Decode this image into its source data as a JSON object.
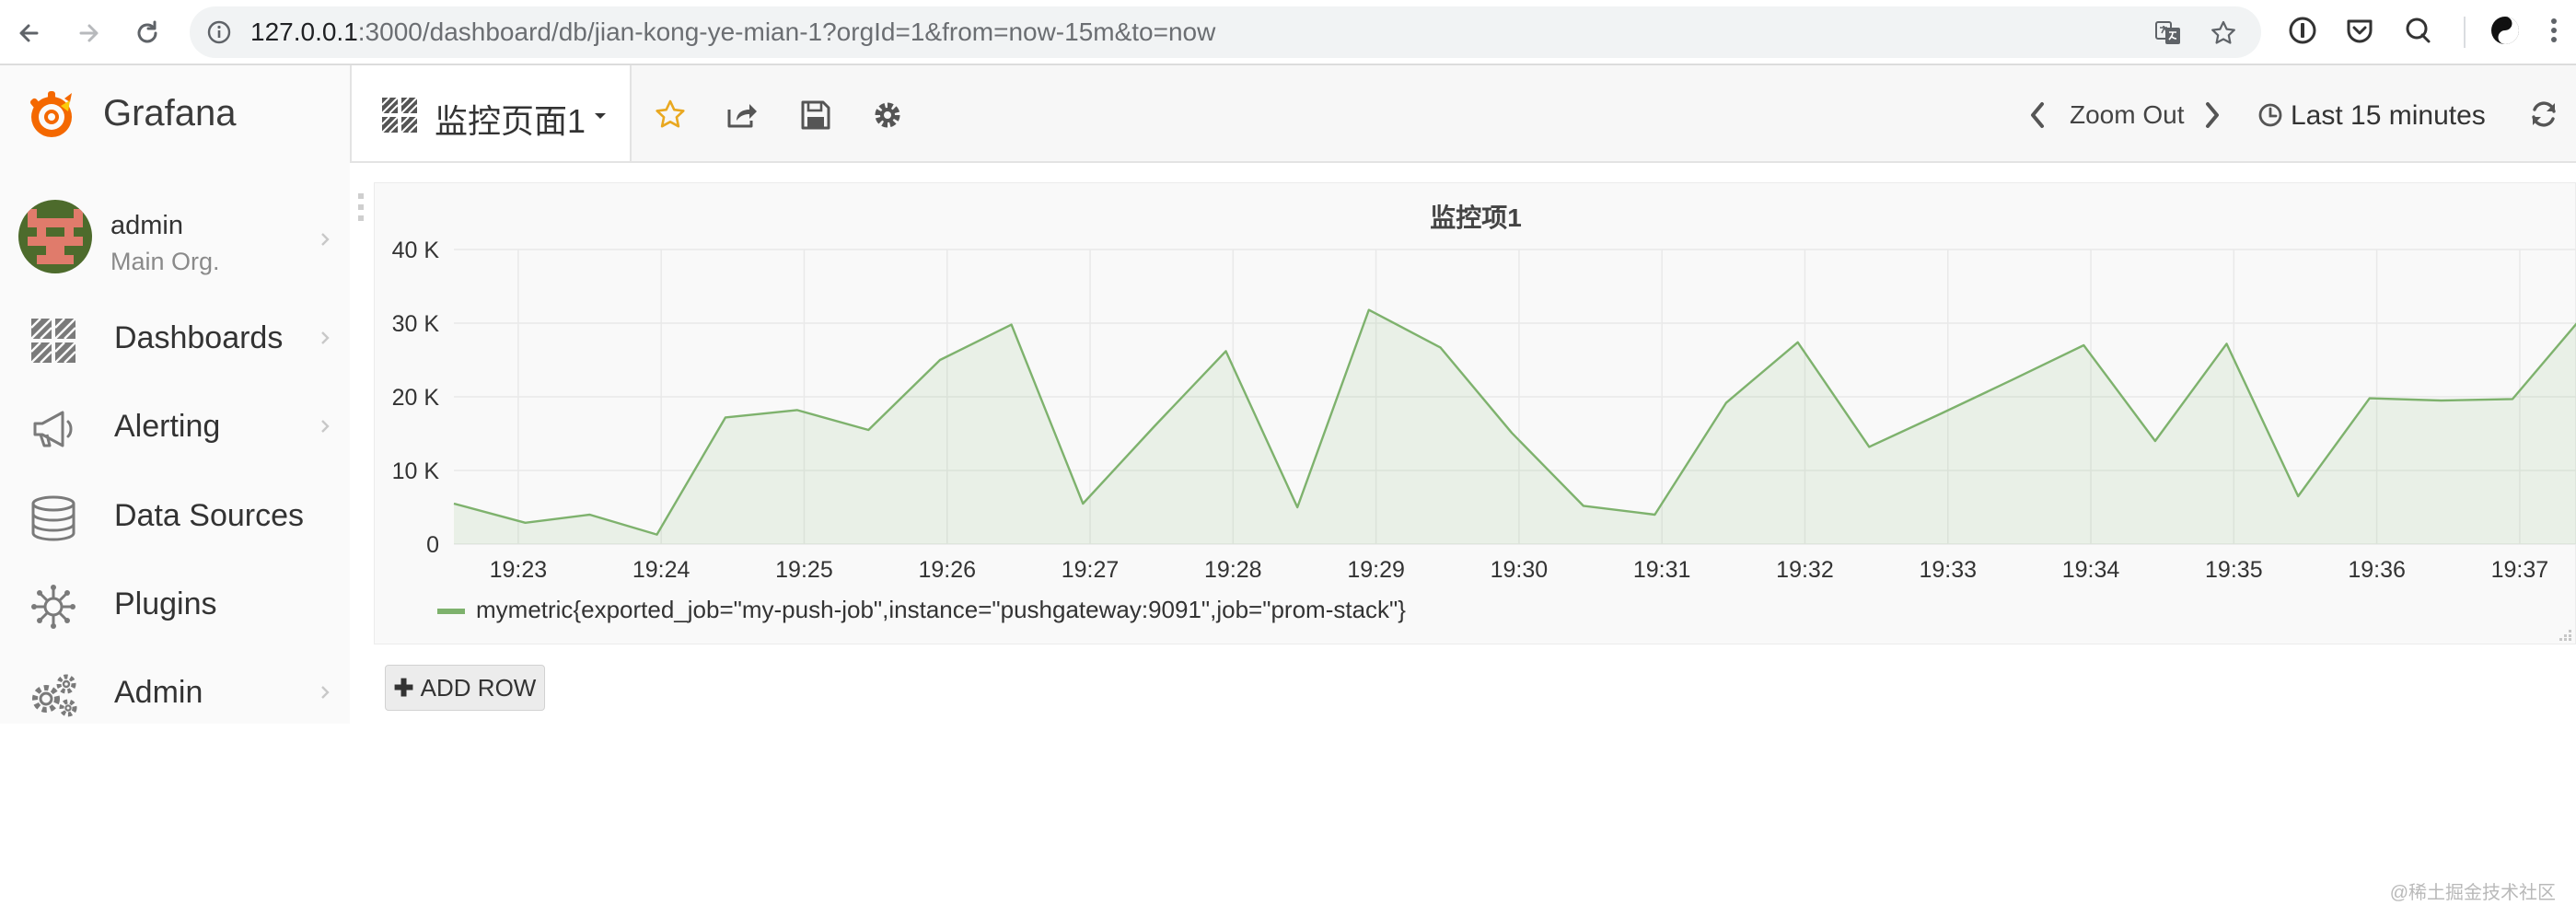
{
  "browser": {
    "url_host": "127.0.0.1",
    "url_rest": ":3000/dashboard/db/jian-kong-ye-mian-1?orgId=1&from=now-15m&to=now"
  },
  "brand": {
    "name": "Grafana",
    "color": "#f46800"
  },
  "user": {
    "name": "admin",
    "org": "Main Org."
  },
  "menu": [
    {
      "label": "Dashboards",
      "icon": "dashboards-grid-icon",
      "has_submenu": true
    },
    {
      "label": "Alerting",
      "icon": "megaphone-icon",
      "has_submenu": true
    },
    {
      "label": "Data Sources",
      "icon": "database-icon",
      "has_submenu": false
    },
    {
      "label": "Plugins",
      "icon": "plugins-icon",
      "has_submenu": false
    },
    {
      "label": "Admin",
      "icon": "gears-icon",
      "has_submenu": true
    }
  ],
  "dashboard": {
    "title": "监控页面1",
    "zoom_out": "Zoom Out",
    "time_range": "Last 15 minutes"
  },
  "panel": {
    "title": "监控项1"
  },
  "add_row": "ADD ROW",
  "watermark": "@稀土掘金技术社区",
  "chart_data": {
    "type": "area",
    "title": "监控项1",
    "xlabel": "",
    "ylabel": "",
    "ylim": [
      0,
      40000
    ],
    "y_ticks": [
      0,
      10000,
      20000,
      30000,
      40000
    ],
    "y_tick_labels": [
      "0",
      "10 K",
      "20 K",
      "30 K",
      "40 K"
    ],
    "x_ticks": [
      "19:23",
      "19:24",
      "19:25",
      "19:26",
      "19:27",
      "19:28",
      "19:29",
      "19:30",
      "19:31",
      "19:32",
      "19:33",
      "19:34",
      "19:35",
      "19:36",
      "19:37"
    ],
    "x_range_minutes": [
      22.55,
      37.4
    ],
    "grid": true,
    "legend_position": "bottom-left",
    "series": [
      {
        "name": "mymetric{exported_job=\"my-push-job\",instance=\"pushgateway:9091\",job=\"prom-stack\"}",
        "color": "#7eb26d",
        "minutes": [
          22.55,
          23.05,
          23.5,
          23.97,
          24.45,
          24.95,
          25.45,
          25.95,
          26.45,
          26.95,
          27.45,
          27.95,
          28.45,
          28.95,
          29.45,
          29.95,
          30.45,
          30.95,
          31.45,
          31.95,
          32.45,
          32.95,
          33.45,
          33.95,
          34.45,
          34.95,
          35.45,
          35.95,
          36.45,
          36.95,
          37.4
        ],
        "values": [
          5500,
          2900,
          4000,
          1300,
          17200,
          18200,
          15500,
          25000,
          29800,
          5500,
          16000,
          26200,
          5000,
          31800,
          26700,
          15100,
          5200,
          4000,
          19200,
          27400,
          13200,
          17700,
          22300,
          27000,
          14000,
          27200,
          6500,
          19800,
          19500,
          19700,
          30000
        ]
      }
    ]
  }
}
